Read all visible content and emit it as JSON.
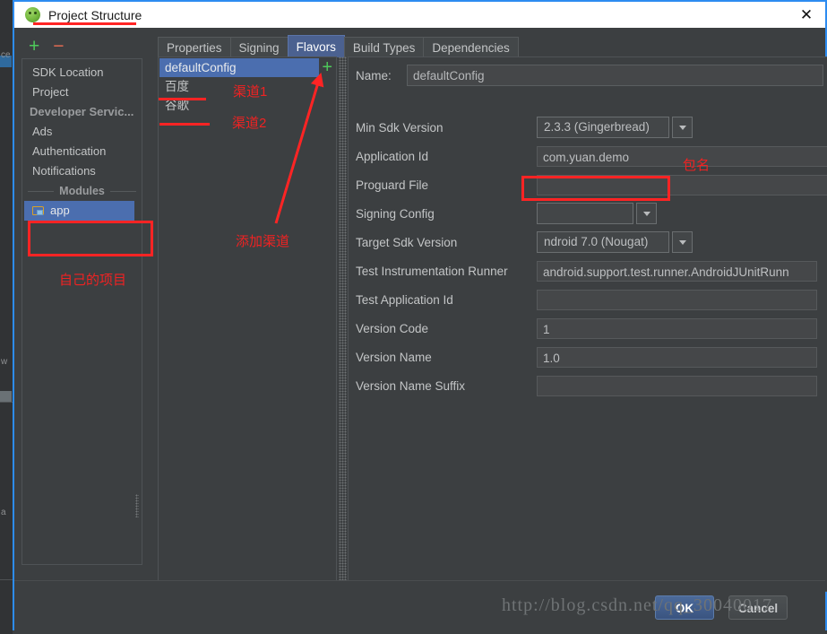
{
  "window": {
    "title": "Project Structure",
    "app_icon": "android-studio-icon",
    "close_icon": "✕"
  },
  "left_toolbar": {
    "add_label": "+",
    "remove_label": "−"
  },
  "sidebar": {
    "items": [
      {
        "label": "SDK Location",
        "type": "item",
        "selected": false
      },
      {
        "label": "Project",
        "type": "item",
        "selected": false
      },
      {
        "label": "Developer Servic...",
        "type": "header",
        "selected": false
      },
      {
        "label": "Ads",
        "type": "item",
        "selected": false
      },
      {
        "label": "Authentication",
        "type": "item",
        "selected": false
      },
      {
        "label": "Notifications",
        "type": "item",
        "selected": false
      },
      {
        "label": "Modules",
        "type": "separator",
        "selected": false
      },
      {
        "label": "app",
        "type": "module",
        "selected": true,
        "icon": "folder-icon"
      }
    ]
  },
  "tabs": [
    {
      "label": "Properties",
      "active": false
    },
    {
      "label": "Signing",
      "active": false
    },
    {
      "label": "Flavors",
      "active": true
    },
    {
      "label": "Build Types",
      "active": false
    },
    {
      "label": "Dependencies",
      "active": false
    }
  ],
  "flavors": {
    "add_button_label": "+",
    "items": [
      {
        "label": "defaultConfig",
        "selected": true
      },
      {
        "label": "百度",
        "selected": false
      },
      {
        "label": "谷歌",
        "selected": false
      }
    ]
  },
  "form": {
    "name_label": "Name:",
    "name_value": "defaultConfig",
    "rows": [
      {
        "label": "Min Sdk Version",
        "value": "2.3.3 (Gingerbread)",
        "kind": "combo-minsdk"
      },
      {
        "label": "Application Id",
        "value": "com.yuan.demo",
        "kind": "text-wide"
      },
      {
        "label": "Proguard File",
        "value": "",
        "kind": "text-wide"
      },
      {
        "label": "Signing Config",
        "value": "",
        "kind": "combo-signing"
      },
      {
        "label": "Target Sdk Version",
        "value": "ndroid 7.0 (Nougat)",
        "kind": "combo-target"
      },
      {
        "label": "Test Instrumentation Runner",
        "value": "android.support.test.runner.AndroidJUnitRunn",
        "kind": "text"
      },
      {
        "label": "Test Application Id",
        "value": "",
        "kind": "text"
      },
      {
        "label": "Version Code",
        "value": "1",
        "kind": "text"
      },
      {
        "label": "Version Name",
        "value": "1.0",
        "kind": "text"
      },
      {
        "label": "Version Name Suffix",
        "value": "",
        "kind": "text"
      }
    ]
  },
  "annotations": {
    "color": "#ff2424",
    "project_note": "自己的项目",
    "channel1": "渠道1",
    "channel2": "渠道2",
    "add_channel": "添加渠道",
    "package_name": "包名"
  },
  "footer": {
    "ok_label": "OK",
    "cancel_label": "Cancel",
    "watermark": "http://blog.csdn.net/qq_30040017"
  }
}
